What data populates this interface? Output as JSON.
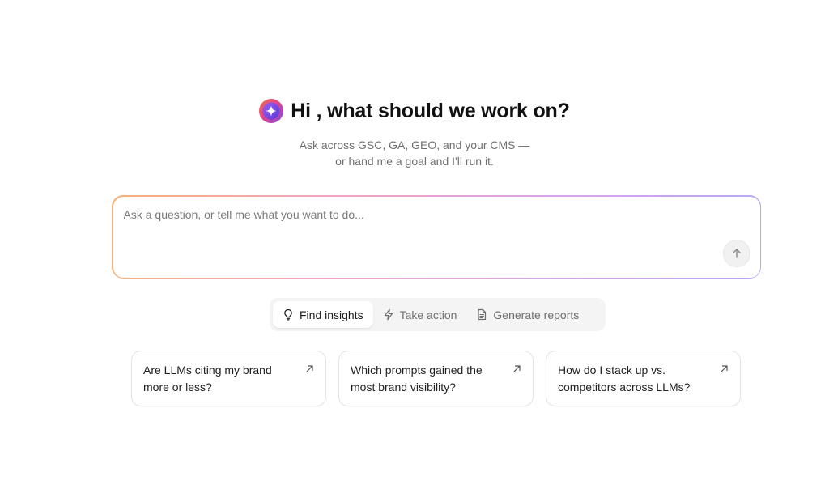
{
  "header": {
    "title": "Hi , what should we work on?",
    "subtitle_line1": "Ask across GSC, GA, GEO, and your CMS —",
    "subtitle_line2": "or hand me a goal and I'll run it.",
    "logo_icon": "sparkle-logo-icon"
  },
  "prompt": {
    "placeholder": "Ask a question, or tell me what you want to do...",
    "value": "",
    "send_icon": "arrow-up-icon"
  },
  "modes": [
    {
      "label": "Find insights",
      "icon": "lightbulb-icon",
      "active": true
    },
    {
      "label": "Take action",
      "icon": "lightning-icon",
      "active": false
    },
    {
      "label": "Generate reports",
      "icon": "document-icon",
      "active": false
    }
  ],
  "suggestions": [
    {
      "text": "Are LLMs citing my brand more or less?",
      "icon": "arrow-up-right-icon"
    },
    {
      "text": "Which prompts gained the most brand visibility?",
      "icon": "arrow-up-right-icon"
    },
    {
      "text": "How do I stack up vs. competitors across LLMs?",
      "icon": "arrow-up-right-icon"
    }
  ],
  "colors": {
    "gradient_start": "#f7b27a",
    "gradient_mid": "#f0a3c4",
    "gradient_end": "#b9a8f3",
    "logo_outer": "#e0428c",
    "logo_inner": "#7b4de0"
  }
}
